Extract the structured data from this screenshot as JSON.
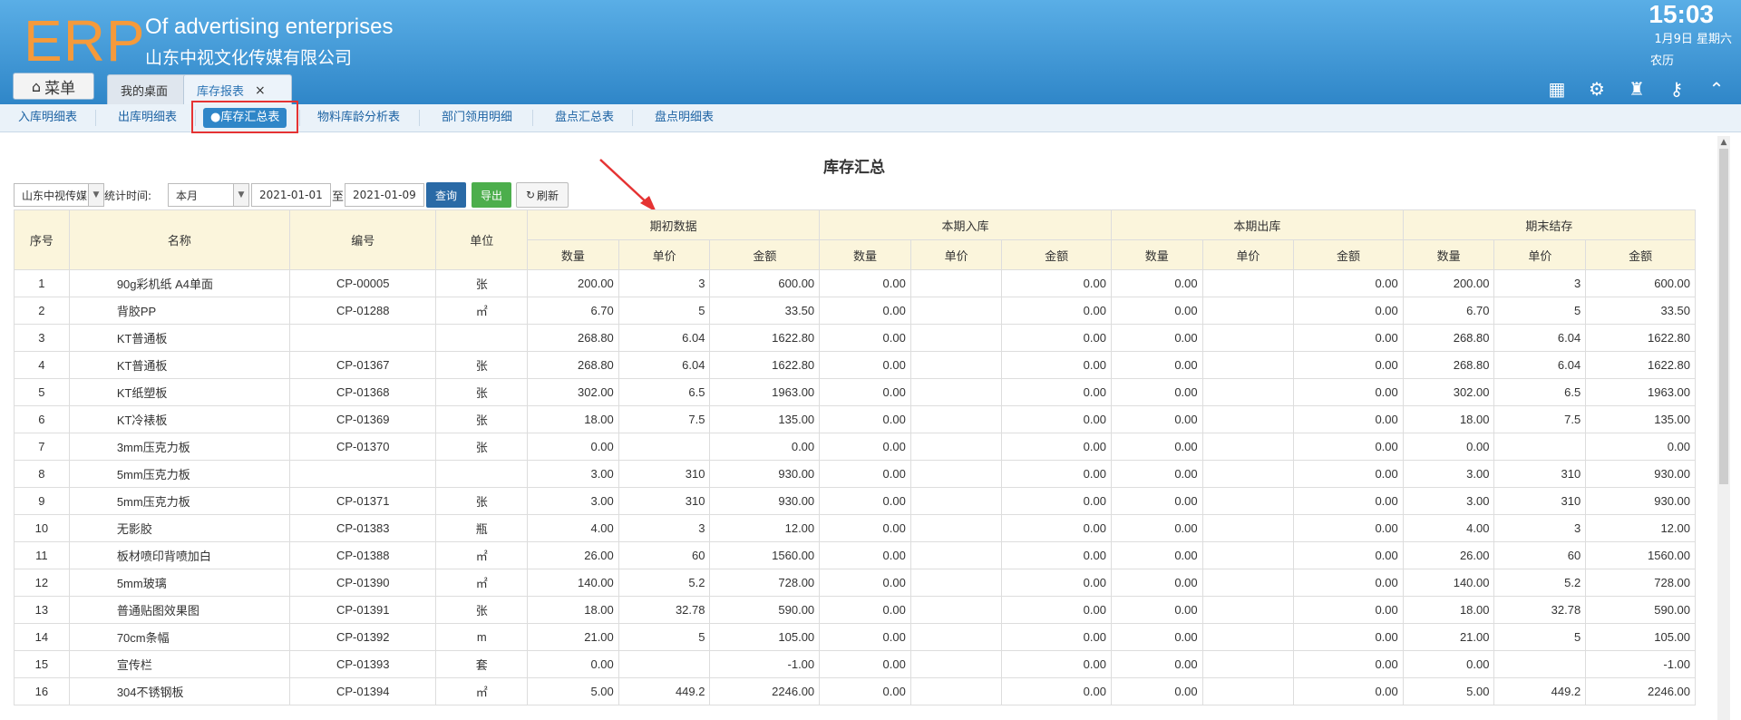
{
  "header": {
    "logo": "ERP",
    "brand_en": "Of advertising enterprises",
    "brand_cn": "山东中视文化传媒有限公司",
    "time": "15:03",
    "date": "1月9日 星期六",
    "lunar": "农历",
    "menu_label": "菜单",
    "tabs": [
      {
        "label": "我的桌面"
      },
      {
        "label": "库存报表",
        "close": "×"
      }
    ],
    "icons": [
      "apps-icon",
      "gear-icon",
      "shirt-icon",
      "key-icon",
      "collapse-icon"
    ]
  },
  "subnav": {
    "items": [
      "入库明细表",
      "出库明细表",
      "●库存汇总表",
      "物料库龄分析表",
      "部门领用明细",
      "盘点汇总表",
      "盘点明细表"
    ],
    "active_index": 2
  },
  "page": {
    "title": "库存汇总",
    "company_select": "山东中视传媒",
    "period_label": "统计时间:",
    "period_select": "本月",
    "date_from": "2021-01-01",
    "to_label": "至",
    "date_to": "2021-01-09",
    "query_label": "查询",
    "export_label": "导出",
    "refresh_label": "刷新"
  },
  "table": {
    "fixed_headers": [
      "序号",
      "名称",
      "编号",
      "单位"
    ],
    "groups": [
      "期初数据",
      "本期入库",
      "本期出库",
      "期末结存"
    ],
    "sub_headers": [
      "数量",
      "单价",
      "金额"
    ],
    "rows": [
      [
        "1",
        "90g彩机纸 A4单面",
        "CP-00005",
        "张",
        "200.00",
        "3",
        "600.00",
        "0.00",
        "",
        "0.00",
        "0.00",
        "",
        "0.00",
        "200.00",
        "3",
        "600.00"
      ],
      [
        "2",
        "背胶PP",
        "CP-01288",
        "㎡",
        "6.70",
        "5",
        "33.50",
        "0.00",
        "",
        "0.00",
        "0.00",
        "",
        "0.00",
        "6.70",
        "5",
        "33.50"
      ],
      [
        "3",
        "KT普通板",
        "",
        "",
        "268.80",
        "6.04",
        "1622.80",
        "0.00",
        "",
        "0.00",
        "0.00",
        "",
        "0.00",
        "268.80",
        "6.04",
        "1622.80"
      ],
      [
        "4",
        "KT普通板",
        "CP-01367",
        "张",
        "268.80",
        "6.04",
        "1622.80",
        "0.00",
        "",
        "0.00",
        "0.00",
        "",
        "0.00",
        "268.80",
        "6.04",
        "1622.80"
      ],
      [
        "5",
        "KT纸塑板",
        "CP-01368",
        "张",
        "302.00",
        "6.5",
        "1963.00",
        "0.00",
        "",
        "0.00",
        "0.00",
        "",
        "0.00",
        "302.00",
        "6.5",
        "1963.00"
      ],
      [
        "6",
        "KT冷裱板",
        "CP-01369",
        "张",
        "18.00",
        "7.5",
        "135.00",
        "0.00",
        "",
        "0.00",
        "0.00",
        "",
        "0.00",
        "18.00",
        "7.5",
        "135.00"
      ],
      [
        "7",
        "3mm压克力板",
        "CP-01370",
        "张",
        "0.00",
        "",
        "0.00",
        "0.00",
        "",
        "0.00",
        "0.00",
        "",
        "0.00",
        "0.00",
        "",
        "0.00"
      ],
      [
        "8",
        "5mm压克力板",
        "",
        "",
        "3.00",
        "310",
        "930.00",
        "0.00",
        "",
        "0.00",
        "0.00",
        "",
        "0.00",
        "3.00",
        "310",
        "930.00"
      ],
      [
        "9",
        "5mm压克力板",
        "CP-01371",
        "张",
        "3.00",
        "310",
        "930.00",
        "0.00",
        "",
        "0.00",
        "0.00",
        "",
        "0.00",
        "3.00",
        "310",
        "930.00"
      ],
      [
        "10",
        "无影胶",
        "CP-01383",
        "瓶",
        "4.00",
        "3",
        "12.00",
        "0.00",
        "",
        "0.00",
        "0.00",
        "",
        "0.00",
        "4.00",
        "3",
        "12.00"
      ],
      [
        "11",
        "板材喷印背喷加白",
        "CP-01388",
        "㎡",
        "26.00",
        "60",
        "1560.00",
        "0.00",
        "",
        "0.00",
        "0.00",
        "",
        "0.00",
        "26.00",
        "60",
        "1560.00"
      ],
      [
        "12",
        "5mm玻璃",
        "CP-01390",
        "㎡",
        "140.00",
        "5.2",
        "728.00",
        "0.00",
        "",
        "0.00",
        "0.00",
        "",
        "0.00",
        "140.00",
        "5.2",
        "728.00"
      ],
      [
        "13",
        "普通贴图效果图",
        "CP-01391",
        "张",
        "18.00",
        "32.78",
        "590.00",
        "0.00",
        "",
        "0.00",
        "0.00",
        "",
        "0.00",
        "18.00",
        "32.78",
        "590.00"
      ],
      [
        "14",
        "70cm条幅",
        "CP-01392",
        "m",
        "21.00",
        "5",
        "105.00",
        "0.00",
        "",
        "0.00",
        "0.00",
        "",
        "0.00",
        "21.00",
        "5",
        "105.00"
      ],
      [
        "15",
        "宣传栏",
        "CP-01393",
        "套",
        "0.00",
        "",
        "-1.00",
        "0.00",
        "",
        "0.00",
        "0.00",
        "",
        "0.00",
        "0.00",
        "",
        "-1.00"
      ],
      [
        "16",
        "304不锈钢板",
        "CP-01394",
        "㎡",
        "5.00",
        "449.2",
        "2246.00",
        "0.00",
        "",
        "0.00",
        "0.00",
        "",
        "0.00",
        "5.00",
        "449.2",
        "2246.00"
      ]
    ]
  },
  "colors": {
    "header_top": "#5aaee6",
    "header_bottom": "#2f86c8",
    "logo": "#f59a3b",
    "table_header_bg": "#fbf5dc",
    "highlight": "#e53333"
  }
}
